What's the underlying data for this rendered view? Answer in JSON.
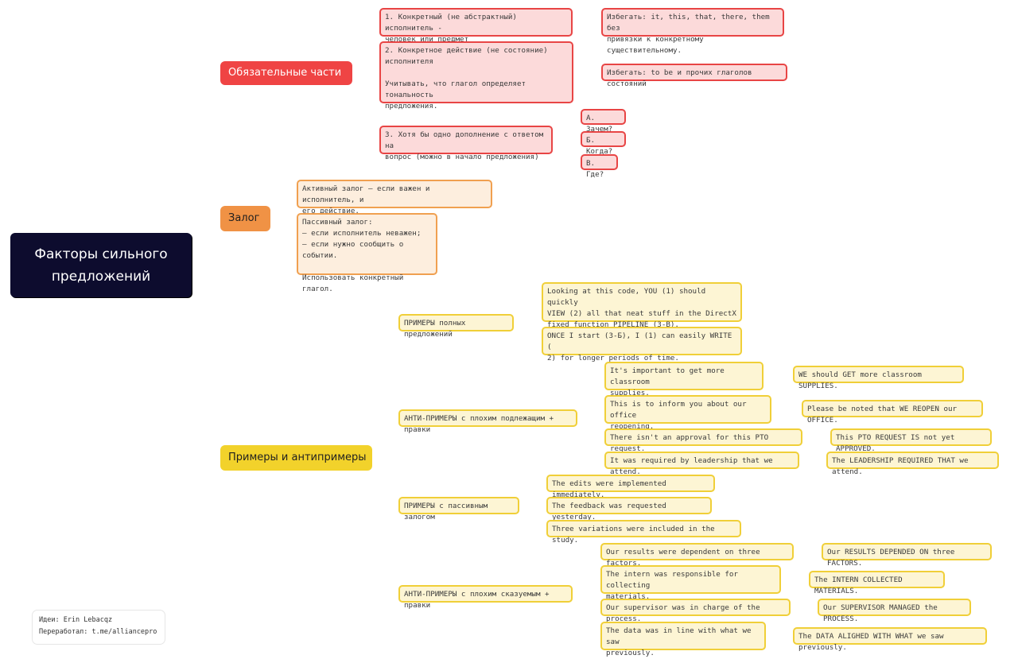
{
  "colors": {
    "root": "#0d0c2e",
    "red": "#ef4444",
    "orange": "#f09245",
    "yellow": "#f2d22b"
  },
  "root": {
    "title": "Факторы сильного\nпредложений"
  },
  "branches": {
    "required": {
      "label": "Обязательные части",
      "items": [
        {
          "text": "1. Конкретный (не абстрактный) исполнитель -\nчеловек или предмет",
          "note": "Избегать: it, this, that, there, them без\nпривязки к конкретному существительному."
        },
        {
          "text": "2. Конкретное действие (не состояние)\nисполнителя\n\nУчитывать, что глагол определяет тональность\nпредложения.",
          "note": "Избегать: to be и прочих глаголов состояний"
        },
        {
          "text": "3. Хотя бы одно дополнение с ответом на\nвопрос (можно в начало предложения)",
          "questions": [
            "А. Зачем?",
            "Б. Когда?",
            "В. Где?"
          ]
        }
      ]
    },
    "voice": {
      "label": "Залог",
      "items": [
        "Активный залог — если важен и исполнитель, и\nего действие.",
        "Пассивный залог:\n— если исполнитель неважен;\n— если нужно сообщить о событии.\n\nИспользовать конкретный глагол."
      ]
    },
    "examples": {
      "label": "Примеры и антипримеры",
      "groups": [
        {
          "label": "ПРИМЕРЫ полных предложений",
          "items": [
            {
              "text": "Looking at this code, YOU (1) should quickly\nVIEW (2) all that neat stuff in the DirectX\nfixed function PIPELINE (3-В)."
            },
            {
              "text": "ONCE I start (3-Б), I (1) can easily WRITE (\n2) for longer periods of time."
            }
          ]
        },
        {
          "label": "АНТИ-ПРИМЕРЫ с плохим подлежащим + правки",
          "items": [
            {
              "text": "It's important to get more classroom\nsupplies.",
              "fix": "WE should GET more classroom SUPPLIES."
            },
            {
              "text": "This is to inform you about our office\nreopening.",
              "fix": "Please be noted that WE REOPEN our OFFICE."
            },
            {
              "text": "There isn't an approval for this PTO request.",
              "fix": "This PTO REQUEST IS not yet APPROVED."
            },
            {
              "text": "It was required by leadership that we attend.",
              "fix": "The LEADERSHIP REQUIRED THAT we attend."
            }
          ]
        },
        {
          "label": "ПРИМЕРЫ с пассивным залогом",
          "items": [
            {
              "text": "The edits were implemented immediately."
            },
            {
              "text": "The feedback was requested yesterday."
            },
            {
              "text": "Three variations were included in the study."
            }
          ]
        },
        {
          "label": "АНТИ-ПРИМЕРЫ с плохим сказуемым + правки",
          "items": [
            {
              "text": "Our results were dependent on three factors.",
              "fix": "Our RESULTS DEPENDED ON three FACTORS."
            },
            {
              "text": "The intern was responsible for collecting\nmaterials.",
              "fix": "The INTERN COLLECTED MATERIALS."
            },
            {
              "text": "Our supervisor was in charge of the process.",
              "fix": "Our SUPERVISOR MANAGED the PROCESS."
            },
            {
              "text": "The data was in line with what we saw\npreviously.",
              "fix": "The DATA ALIGHED WITH WHAT we saw previously."
            }
          ]
        }
      ]
    }
  },
  "credits": {
    "text": "Идеи: Erin Lebacqz\nПереработал: t.me/alliancepro"
  }
}
